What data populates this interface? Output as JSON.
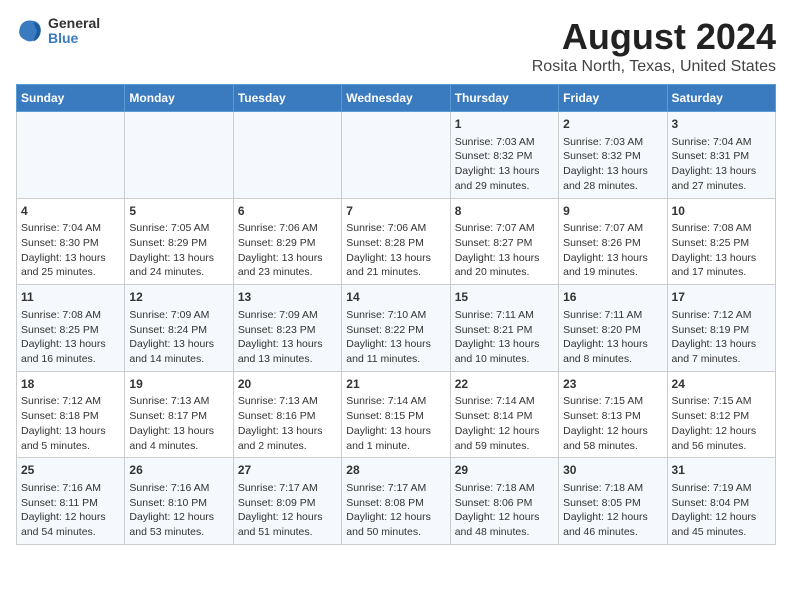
{
  "header": {
    "logo_general": "General",
    "logo_blue": "Blue",
    "title": "August 2024",
    "subtitle": "Rosita North, Texas, United States"
  },
  "days_of_week": [
    "Sunday",
    "Monday",
    "Tuesday",
    "Wednesday",
    "Thursday",
    "Friday",
    "Saturday"
  ],
  "weeks": [
    [
      {
        "day": "",
        "info": ""
      },
      {
        "day": "",
        "info": ""
      },
      {
        "day": "",
        "info": ""
      },
      {
        "day": "",
        "info": ""
      },
      {
        "day": "1",
        "info": "Sunrise: 7:03 AM\nSunset: 8:32 PM\nDaylight: 13 hours\nand 29 minutes."
      },
      {
        "day": "2",
        "info": "Sunrise: 7:03 AM\nSunset: 8:32 PM\nDaylight: 13 hours\nand 28 minutes."
      },
      {
        "day": "3",
        "info": "Sunrise: 7:04 AM\nSunset: 8:31 PM\nDaylight: 13 hours\nand 27 minutes."
      }
    ],
    [
      {
        "day": "4",
        "info": "Sunrise: 7:04 AM\nSunset: 8:30 PM\nDaylight: 13 hours\nand 25 minutes."
      },
      {
        "day": "5",
        "info": "Sunrise: 7:05 AM\nSunset: 8:29 PM\nDaylight: 13 hours\nand 24 minutes."
      },
      {
        "day": "6",
        "info": "Sunrise: 7:06 AM\nSunset: 8:29 PM\nDaylight: 13 hours\nand 23 minutes."
      },
      {
        "day": "7",
        "info": "Sunrise: 7:06 AM\nSunset: 8:28 PM\nDaylight: 13 hours\nand 21 minutes."
      },
      {
        "day": "8",
        "info": "Sunrise: 7:07 AM\nSunset: 8:27 PM\nDaylight: 13 hours\nand 20 minutes."
      },
      {
        "day": "9",
        "info": "Sunrise: 7:07 AM\nSunset: 8:26 PM\nDaylight: 13 hours\nand 19 minutes."
      },
      {
        "day": "10",
        "info": "Sunrise: 7:08 AM\nSunset: 8:25 PM\nDaylight: 13 hours\nand 17 minutes."
      }
    ],
    [
      {
        "day": "11",
        "info": "Sunrise: 7:08 AM\nSunset: 8:25 PM\nDaylight: 13 hours\nand 16 minutes."
      },
      {
        "day": "12",
        "info": "Sunrise: 7:09 AM\nSunset: 8:24 PM\nDaylight: 13 hours\nand 14 minutes."
      },
      {
        "day": "13",
        "info": "Sunrise: 7:09 AM\nSunset: 8:23 PM\nDaylight: 13 hours\nand 13 minutes."
      },
      {
        "day": "14",
        "info": "Sunrise: 7:10 AM\nSunset: 8:22 PM\nDaylight: 13 hours\nand 11 minutes."
      },
      {
        "day": "15",
        "info": "Sunrise: 7:11 AM\nSunset: 8:21 PM\nDaylight: 13 hours\nand 10 minutes."
      },
      {
        "day": "16",
        "info": "Sunrise: 7:11 AM\nSunset: 8:20 PM\nDaylight: 13 hours\nand 8 minutes."
      },
      {
        "day": "17",
        "info": "Sunrise: 7:12 AM\nSunset: 8:19 PM\nDaylight: 13 hours\nand 7 minutes."
      }
    ],
    [
      {
        "day": "18",
        "info": "Sunrise: 7:12 AM\nSunset: 8:18 PM\nDaylight: 13 hours\nand 5 minutes."
      },
      {
        "day": "19",
        "info": "Sunrise: 7:13 AM\nSunset: 8:17 PM\nDaylight: 13 hours\nand 4 minutes."
      },
      {
        "day": "20",
        "info": "Sunrise: 7:13 AM\nSunset: 8:16 PM\nDaylight: 13 hours\nand 2 minutes."
      },
      {
        "day": "21",
        "info": "Sunrise: 7:14 AM\nSunset: 8:15 PM\nDaylight: 13 hours\nand 1 minute."
      },
      {
        "day": "22",
        "info": "Sunrise: 7:14 AM\nSunset: 8:14 PM\nDaylight: 12 hours\nand 59 minutes."
      },
      {
        "day": "23",
        "info": "Sunrise: 7:15 AM\nSunset: 8:13 PM\nDaylight: 12 hours\nand 58 minutes."
      },
      {
        "day": "24",
        "info": "Sunrise: 7:15 AM\nSunset: 8:12 PM\nDaylight: 12 hours\nand 56 minutes."
      }
    ],
    [
      {
        "day": "25",
        "info": "Sunrise: 7:16 AM\nSunset: 8:11 PM\nDaylight: 12 hours\nand 54 minutes."
      },
      {
        "day": "26",
        "info": "Sunrise: 7:16 AM\nSunset: 8:10 PM\nDaylight: 12 hours\nand 53 minutes."
      },
      {
        "day": "27",
        "info": "Sunrise: 7:17 AM\nSunset: 8:09 PM\nDaylight: 12 hours\nand 51 minutes."
      },
      {
        "day": "28",
        "info": "Sunrise: 7:17 AM\nSunset: 8:08 PM\nDaylight: 12 hours\nand 50 minutes."
      },
      {
        "day": "29",
        "info": "Sunrise: 7:18 AM\nSunset: 8:06 PM\nDaylight: 12 hours\nand 48 minutes."
      },
      {
        "day": "30",
        "info": "Sunrise: 7:18 AM\nSunset: 8:05 PM\nDaylight: 12 hours\nand 46 minutes."
      },
      {
        "day": "31",
        "info": "Sunrise: 7:19 AM\nSunset: 8:04 PM\nDaylight: 12 hours\nand 45 minutes."
      }
    ]
  ]
}
